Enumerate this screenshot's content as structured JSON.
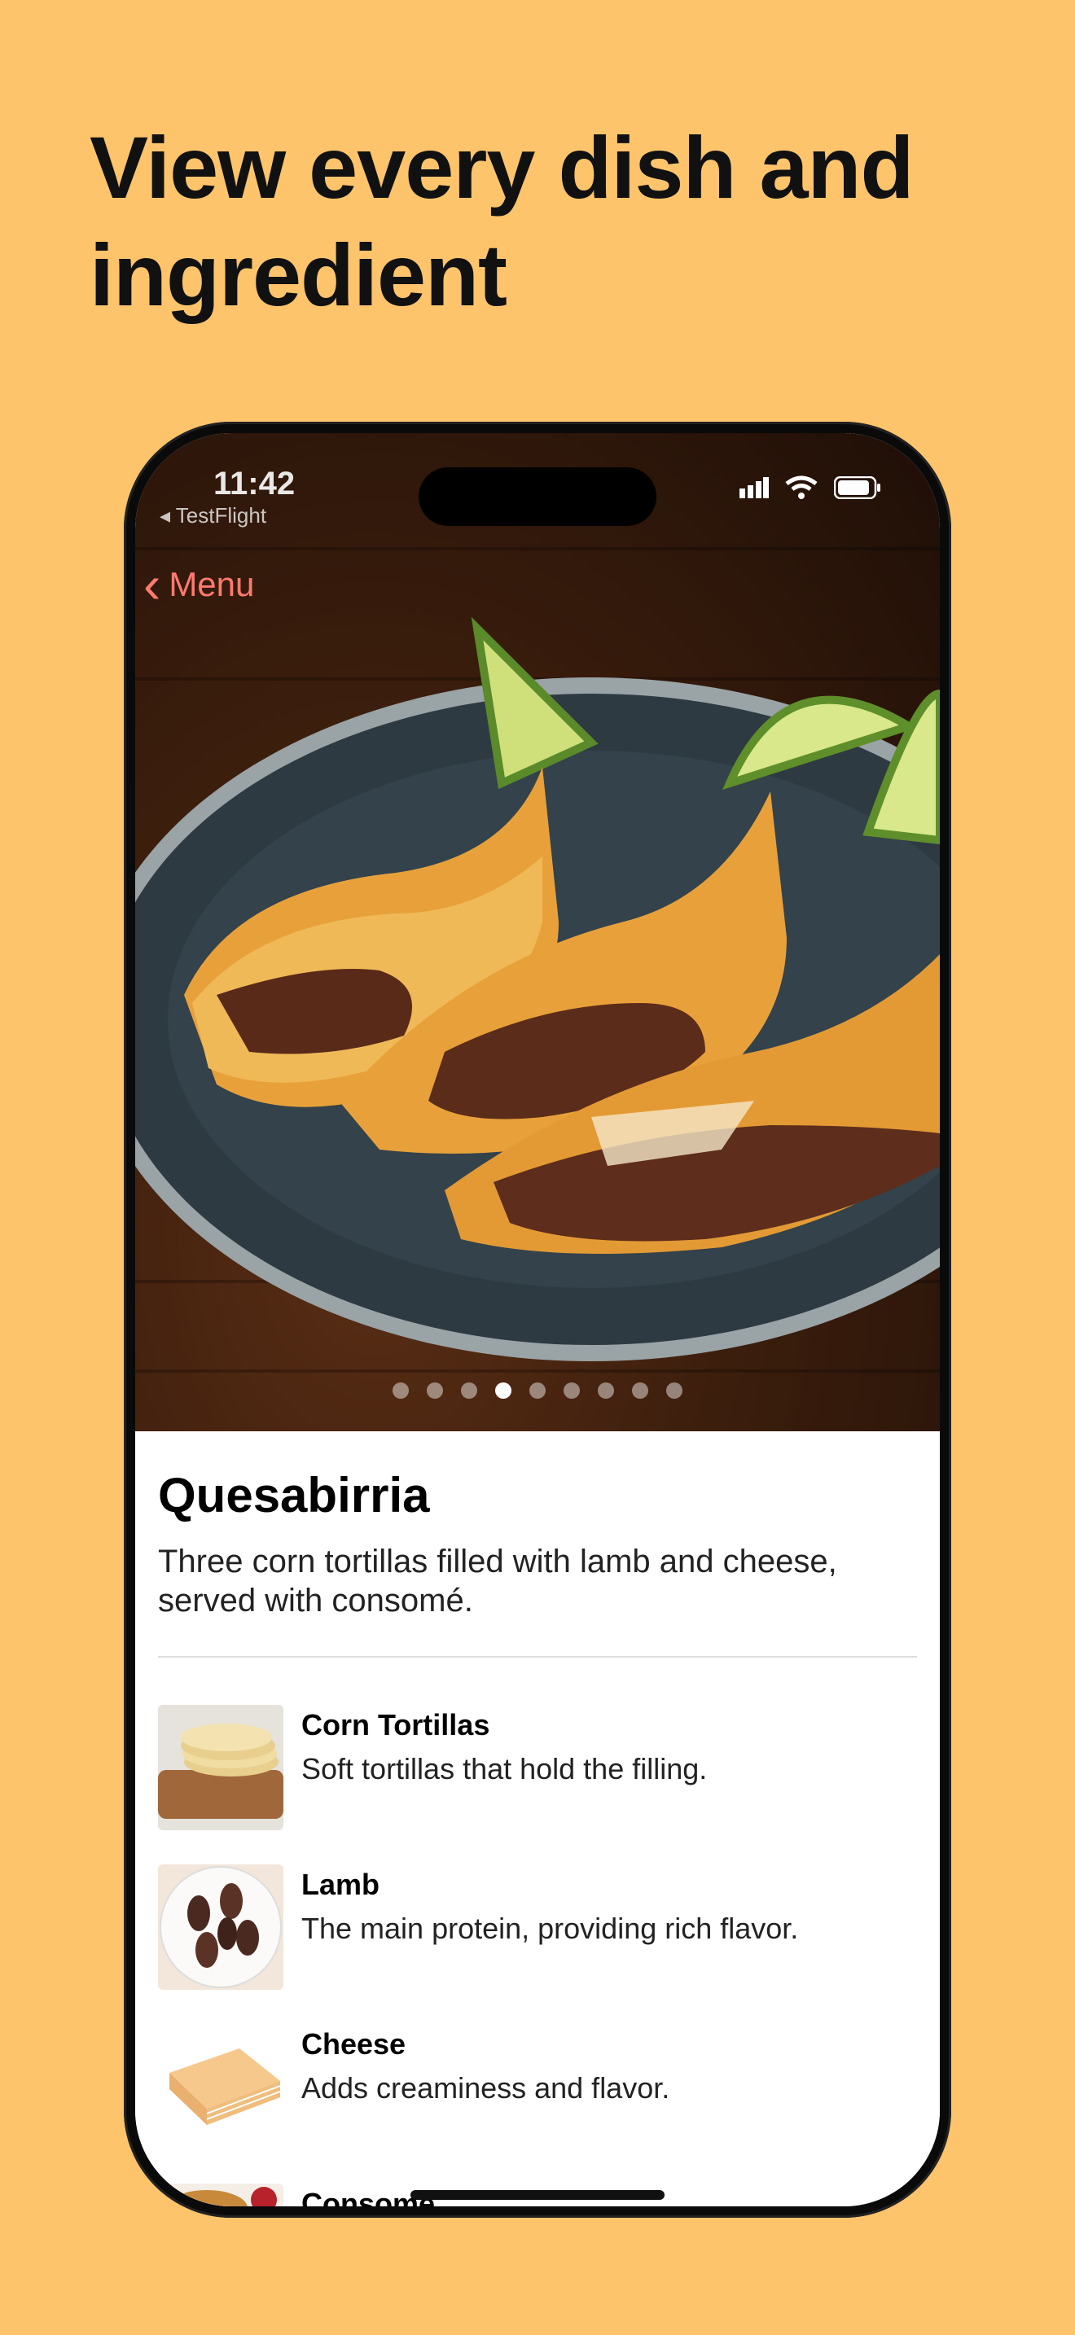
{
  "headline": "View every dish and ingredient",
  "status_bar": {
    "time": "11:42",
    "back_app": "◂ TestFlight"
  },
  "nav": {
    "back_label": "Menu"
  },
  "carousel": {
    "total_pages": 9,
    "active_index": 3
  },
  "dish": {
    "title": "Quesabirria",
    "description": "Three corn tortillas filled with lamb and cheese, served with consomé."
  },
  "ingredients": [
    {
      "name": "Corn Tortillas",
      "note": "Soft tortillas that hold the filling.",
      "icon": "tortillas-image"
    },
    {
      "name": "Lamb",
      "note": "The main protein, providing rich flavor.",
      "icon": "lamb-image"
    },
    {
      "name": "Cheese",
      "note": "Adds creaminess and flavor.",
      "icon": "cheese-image"
    },
    {
      "name": "Consomé",
      "note": "",
      "icon": "consome-image"
    }
  ],
  "colors": {
    "background": "#FDC46C",
    "accent": "#FF7A6E"
  }
}
